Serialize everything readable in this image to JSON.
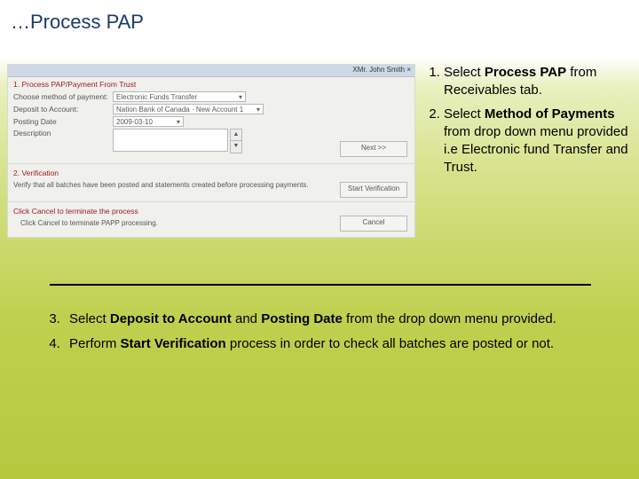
{
  "title": "…Process PAP",
  "app": {
    "titlebar": "XMr. John Smith  ×",
    "section1": "1. Process PAP/Payment From Trust",
    "labels": {
      "method": "Choose method of payment:",
      "deposit": "Deposit to Account:",
      "posting": "Posting Date",
      "description": "Description"
    },
    "values": {
      "method": "Electronic Funds Transfer",
      "deposit": "Nation Bank of Canada · New Account 1",
      "posting": "2009-03-10"
    },
    "buttons": {
      "next": "Next >>",
      "verify": "Start Verification",
      "cancel": "Cancel"
    },
    "section2": "2. Verification",
    "verify_note": "Verify that all batches have been posted and statements created before processing payments.",
    "cancel_hint": "Click Cancel to terminate the process",
    "cancel_detail": "Click Cancel to terminate PAPP processing."
  },
  "steps_right": {
    "s1a": "Select ",
    "s1b": "Process PAP",
    "s1c": " from Receivables tab.",
    "s2a": "Select ",
    "s2b": "Method of Payments",
    "s2c": " from drop down menu provided i.e Electronic fund Transfer and Trust."
  },
  "steps_lower": {
    "s3a": "Select ",
    "s3b": "Deposit to Account",
    "s3c": " and ",
    "s3d": "Posting Date",
    "s3e": " from the drop down menu provided.",
    "s4a": "Perform ",
    "s4b": "Start Verification",
    "s4c": " process in order to check all batches are posted or not."
  }
}
